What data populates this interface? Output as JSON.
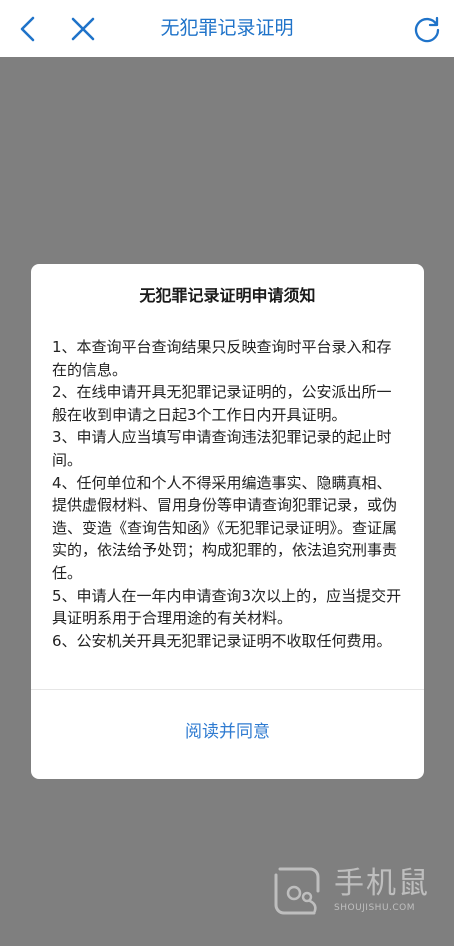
{
  "header": {
    "title": "无犯罪记录证明",
    "back_icon": "chevron-left-icon",
    "close_icon": "close-icon",
    "refresh_icon": "refresh-icon",
    "accent": "#1f73c9"
  },
  "dialog": {
    "title": "无犯罪记录证明申请须知",
    "paragraphs": [
      "1、本查询平台查询结果只反映查询时平台录入和存在的信息。",
      "2、在线申请开具无犯罪记录证明的，公安派出所一般在收到申请之日起3个工作日内开具证明。",
      "3、申请人应当填写申请查询违法犯罪记录的起止时间。",
      "4、任何单位和个人不得采用编造事实、隐瞒真相、提供虚假材料、冒用身份等申请查询犯罪记录，或伪造、变造《查询告知函》《无犯罪记录证明》。查证属实的，依法给予处罚；构成犯罪的，依法追究刑事责任。",
      "5、申请人在一年内申请查询3次以上的，应当提交开具证明系用于合理用途的有关材料。",
      "6、公安机关开具无犯罪记录证明不收取任何费用。"
    ],
    "agree_label": "阅读并同意",
    "agree_color": "#2f7bd1"
  },
  "watermark": {
    "text": "手机鼠",
    "url": "SHOUJISHU.COM",
    "icon": "mouse-logo-icon"
  }
}
